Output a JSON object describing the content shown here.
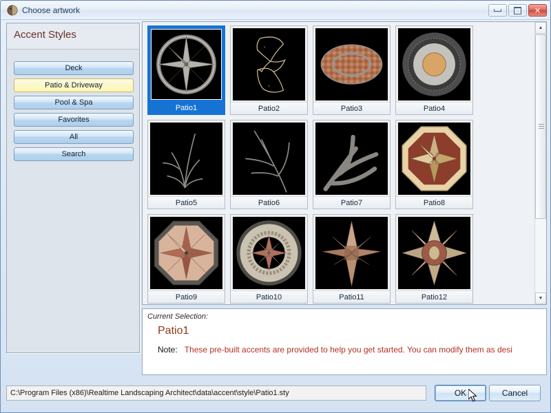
{
  "window": {
    "title": "Choose artwork",
    "icon": "app-palette-icon",
    "controls": {
      "minimize": "minimize-icon",
      "maximize": "maximize-icon",
      "close": "✕"
    }
  },
  "sidebar": {
    "title": "Accent Styles",
    "items": [
      {
        "label": "Deck",
        "selected": false
      },
      {
        "label": "Patio & Driveway",
        "selected": true
      },
      {
        "label": "Pool & Spa",
        "selected": false
      },
      {
        "label": "Favorites",
        "selected": false
      },
      {
        "label": "All",
        "selected": false
      },
      {
        "label": "Search",
        "selected": false
      }
    ]
  },
  "grid": {
    "items": [
      {
        "label": "Patio1",
        "art": "compass-star-ring",
        "selected": true
      },
      {
        "label": "Patio2",
        "art": "outline-ribbon",
        "selected": false
      },
      {
        "label": "Patio3",
        "art": "brick-oval",
        "selected": false
      },
      {
        "label": "Patio4",
        "art": "concentric-circles",
        "selected": false
      },
      {
        "label": "Patio5",
        "art": "thin-branch-spray",
        "selected": false
      },
      {
        "label": "Patio6",
        "art": "thin-branch-curve",
        "selected": false
      },
      {
        "label": "Patio7",
        "art": "thick-branch-fan",
        "selected": false
      },
      {
        "label": "Patio8",
        "art": "octagon-six-star",
        "selected": false
      },
      {
        "label": "Patio9",
        "art": "octagon-eight-star",
        "selected": false
      },
      {
        "label": "Patio10",
        "art": "gravel-compass-medallion",
        "selected": false
      },
      {
        "label": "Patio11",
        "art": "four-point-star",
        "selected": false
      },
      {
        "label": "Patio12",
        "art": "eight-point-sunburst",
        "selected": false
      }
    ],
    "scrollbar": {
      "up_arrow": "▲",
      "down_arrow": "▼"
    }
  },
  "selection": {
    "label": "Current Selection:",
    "value": "Patio1",
    "note_word": "Note:",
    "note_text": "These pre-built accents are provided to help you get started. You can modify them as desi"
  },
  "footer": {
    "path": "C:\\Program Files (x86)\\Realtime Landscaping Architect\\data\\accent\\style\\Patio1.sty",
    "ok_label": "OK",
    "cancel_label": "Cancel"
  },
  "colors": {
    "selection_blue": "#1673d4",
    "category_selected": "#fcf8c9",
    "heading_maroon": "#6b2f2f",
    "note_red": "#b03020",
    "value_orange": "#8a3a14"
  }
}
